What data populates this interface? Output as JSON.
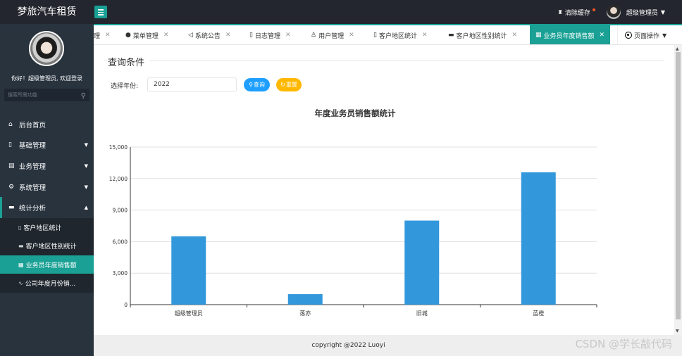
{
  "app": {
    "title": "梦旅汽车租赁"
  },
  "header": {
    "clear_cache": "清除缓存",
    "user": "超级管理员"
  },
  "sidebar": {
    "welcome": "你好！超级管理员, 欢迎登录",
    "search_placeholder": "搜索所需功能",
    "items": [
      {
        "label": "后台首页",
        "icon": "home-icon"
      },
      {
        "label": "基础管理",
        "icon": "file-icon"
      },
      {
        "label": "业务管理",
        "icon": "list-icon"
      },
      {
        "label": "系统管理",
        "icon": "gear-icon"
      },
      {
        "label": "统计分析",
        "icon": "chart-icon"
      }
    ],
    "sub_items": [
      {
        "label": "客户地区统计",
        "icon": "doc-icon"
      },
      {
        "label": "客户地区性别统计",
        "icon": "keyboard-icon"
      },
      {
        "label": "业务员年度销售额",
        "icon": "table-icon"
      },
      {
        "label": "公司年度月份销...",
        "icon": "pulse-icon"
      }
    ]
  },
  "tabs": [
    {
      "label": "理"
    },
    {
      "label": "菜单管理"
    },
    {
      "label": "系统公告"
    },
    {
      "label": "日志管理"
    },
    {
      "label": "用户管理"
    },
    {
      "label": "客户地区统计"
    },
    {
      "label": "客户地区性别统计"
    },
    {
      "label": "业务员年度销售额"
    }
  ],
  "page_ops": "页面操作",
  "form": {
    "legend": "查询条件",
    "year_label": "选择年份:",
    "year_value": "2022",
    "query_button": "查询",
    "reset_button": "重置"
  },
  "chart_data": {
    "type": "bar",
    "title": "年度业务员销售额统计",
    "categories": [
      "超级管理员",
      "落亦",
      "旧城",
      "蓝橙"
    ],
    "values": [
      6500,
      1000,
      8000,
      12600
    ],
    "ylim": [
      0,
      15000
    ],
    "yticks": [
      "0",
      "3,000",
      "6,000",
      "9,000",
      "12,000",
      "15,000"
    ],
    "color": "#3398db",
    "grid": true
  },
  "footer": {
    "copyright": "copyright @2022 Luoyi"
  },
  "watermark": "CSDN @学长敲代码"
}
